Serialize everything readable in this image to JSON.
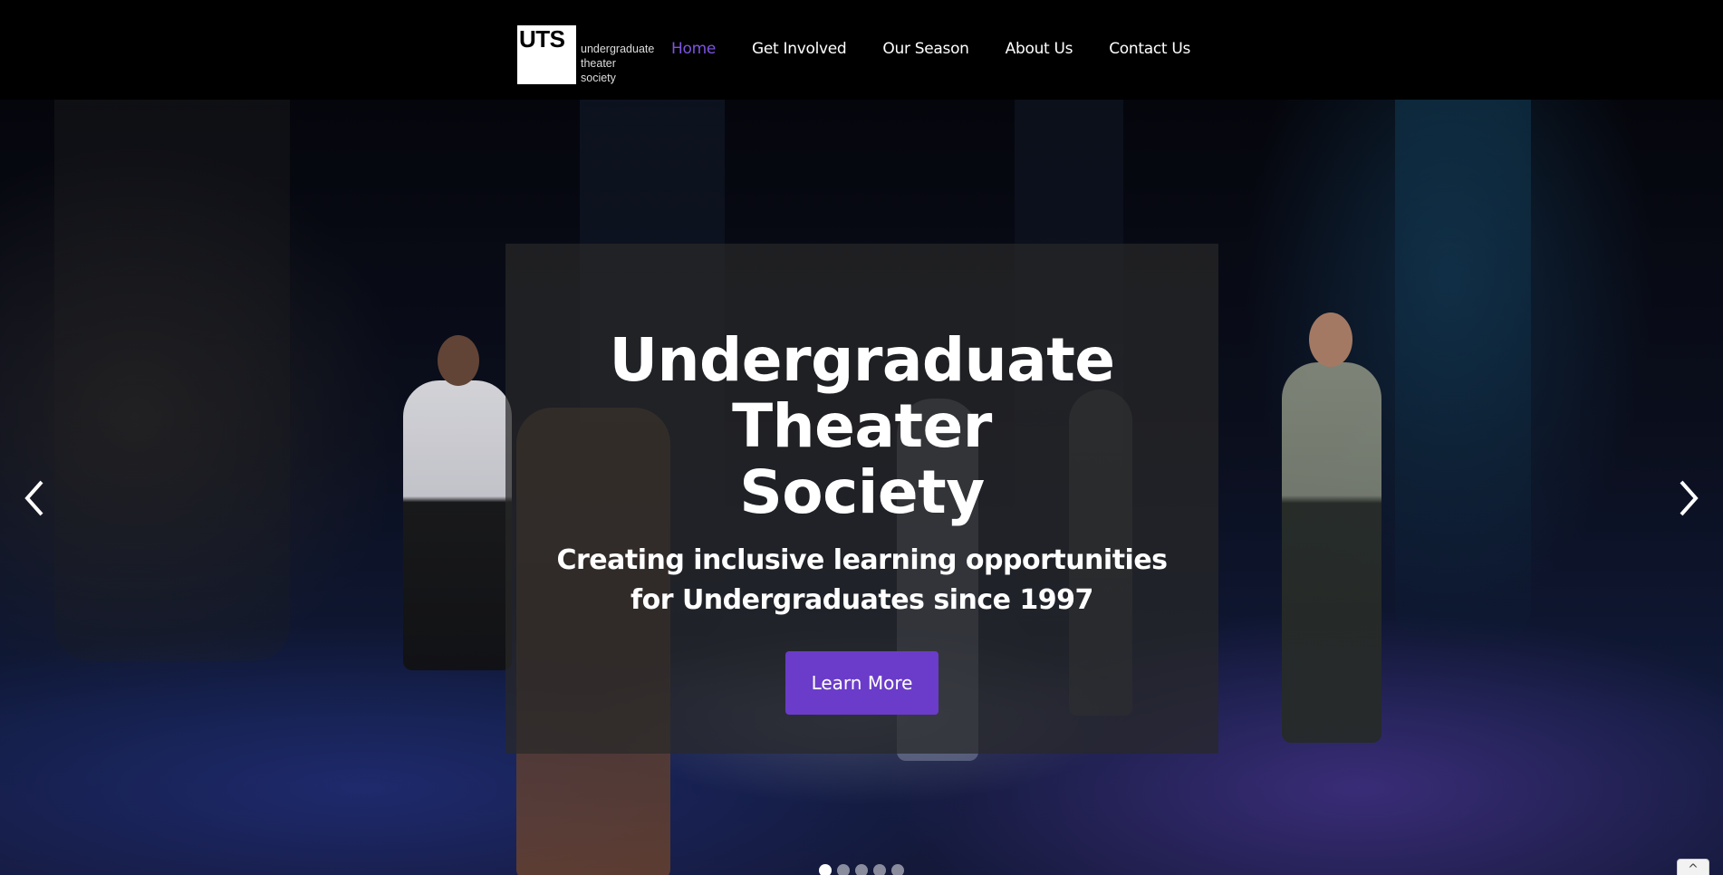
{
  "brand": {
    "logo_mark": "UTS",
    "logo_lines": [
      "undergraduate",
      "theater",
      "society"
    ]
  },
  "nav": {
    "items": [
      {
        "label": "Home",
        "active": true
      },
      {
        "label": "Get Involved",
        "active": false
      },
      {
        "label": "Our Season",
        "active": false
      },
      {
        "label": "About Us",
        "active": false
      },
      {
        "label": "Contact Us",
        "active": false
      }
    ]
  },
  "hero": {
    "title_lines": [
      "Undergraduate",
      "Theater",
      "Society"
    ],
    "subtitle_lines": [
      "Creating inclusive learning opportunities",
      "for Undergraduates since 1997"
    ],
    "cta_label": "Learn More"
  },
  "carousel": {
    "prev_icon": "chevron-left-icon",
    "next_icon": "chevron-right-icon",
    "slide_count": 5,
    "active_index": 0
  },
  "scroll_top": {
    "icon": "chevron-up-icon",
    "glyph": "^"
  },
  "colors": {
    "accent": "#7d55e0",
    "button": "#6a3cc9",
    "background": "#000000"
  }
}
